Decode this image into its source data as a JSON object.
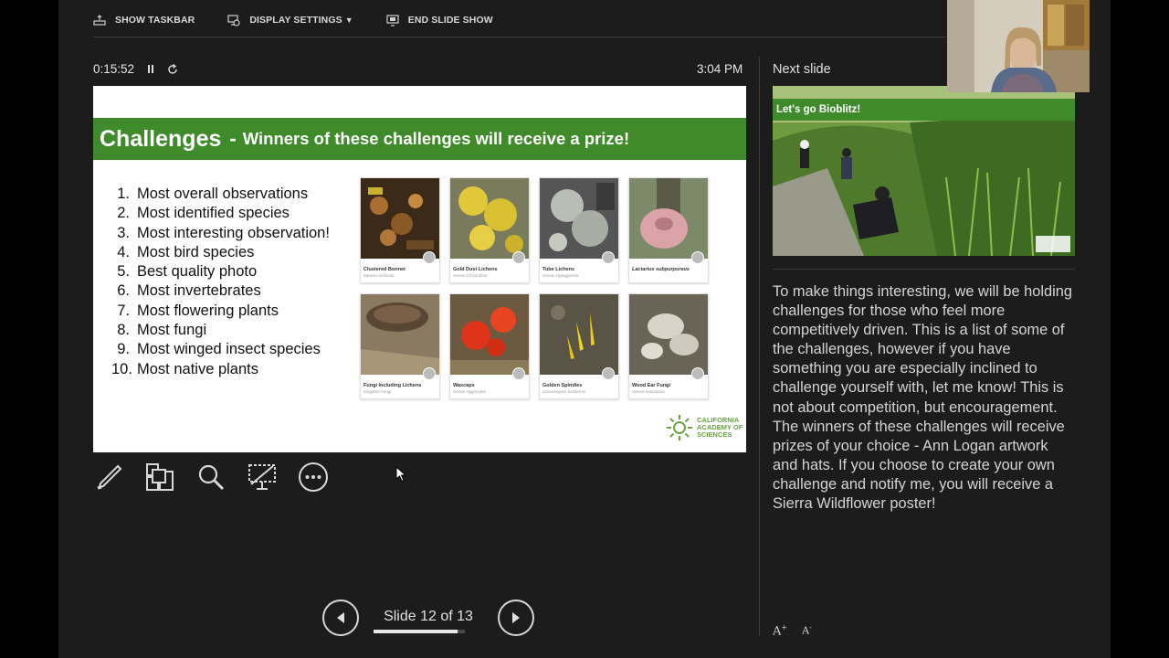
{
  "toolbar": {
    "show_taskbar": "SHOW TASKBAR",
    "display_settings": "DISPLAY SETTINGS",
    "end_slide_show": "END SLIDE SHOW"
  },
  "timer": {
    "elapsed": "0:15:52"
  },
  "clock": "3:04 PM",
  "next_slide_label": "Next slide",
  "slide": {
    "title": "Challenges",
    "subtitle": "Winners of these challenges will receive a prize!",
    "challenges": [
      {
        "n": "1.",
        "text": "Most overall observations"
      },
      {
        "n": "2.",
        "text": "Most identified species"
      },
      {
        "n": "3.",
        "text": "Most interesting observation!"
      },
      {
        "n": "4.",
        "text": "Most bird species"
      },
      {
        "n": "5.",
        "text": "Best quality photo"
      },
      {
        "n": "6.",
        "text": "Most invertebrates"
      },
      {
        "n": "7.",
        "text": "Most flowering plants"
      },
      {
        "n": "8.",
        "text": "Most fungi"
      },
      {
        "n": "9.",
        "text": "Most winged insect species"
      },
      {
        "n": "10.",
        "text": "Most native plants"
      }
    ],
    "cards": [
      {
        "name": "Clustered Bonnet",
        "sci": "Mycena inclinata"
      },
      {
        "name": "Gold Dust Lichens",
        "sci": "Genus Chrysothrix"
      },
      {
        "name": "Tube Lichens",
        "sci": "Genus Hypogymnia"
      },
      {
        "name": "Lactarius subpurpureus",
        "sci": ""
      },
      {
        "name": "Fungi Including Lichens",
        "sci": "Kingdom Fungi"
      },
      {
        "name": "Waxcaps",
        "sci": "Genus Hygrocybe"
      },
      {
        "name": "Golden Spindles",
        "sci": "Clavulinopsis fusiformis"
      },
      {
        "name": "Wood Ear Fungi",
        "sci": "Genus Auricularia"
      }
    ],
    "logo_text": [
      "CALIFORNIA",
      "ACADEMY OF",
      "SCIENCES"
    ]
  },
  "navigation": {
    "slide_position": "Slide 12 of 13",
    "progress_fraction": 0.92
  },
  "next_slide": {
    "title": "Let's go Bioblitz!"
  },
  "notes": "To make things interesting, we will be holding challenges for those who feel more competitively driven. This is a list of some of the challenges, however if you have something you are especially inclined to challenge yourself with, let me know! This is not about competition, but encouragement. The winners of these challenges will receive prizes of your choice - Ann Logan artwork and hats. If you choose to create your own challenge and notify me, you will receive a Sierra Wildflower poster!",
  "colors": {
    "slide_green": "#3f8a2b",
    "background": "#1c1c1c",
    "text": "#d4d4d4"
  }
}
